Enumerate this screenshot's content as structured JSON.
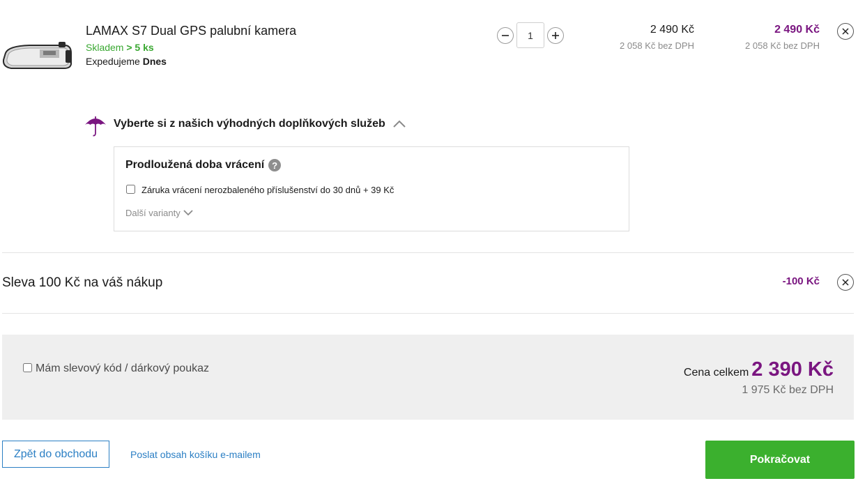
{
  "product": {
    "name": "LAMAX S7 Dual GPS palubní kamera",
    "stock_prefix": "Skladem",
    "stock_value": "> 5 ks",
    "shipping_prefix": "Expedujeme",
    "shipping_value": "Dnes",
    "quantity": "1",
    "unit_price": "2 490 Kč",
    "unit_price_novat": "2 058 Kč bez DPH",
    "total_price": "2 490 Kč",
    "total_price_novat": "2 058 Kč bez DPH"
  },
  "services": {
    "toggle_label": "Vyberte si z našich výhodných doplňkových služeb",
    "box_title": "Prodloužená doba vrácení",
    "help_symbol": "?",
    "warranty_option": "Záruka vrácení nerozbaleného příslušenství do 30 dnů + 39 Kč",
    "more_variants": "Další varianty"
  },
  "discount": {
    "label": "Sleva 100 Kč na váš nákup",
    "value": "-100 Kč"
  },
  "summary": {
    "coupon_label": "Mám slevový kód / dárkový poukaz",
    "total_label": "Cena celkem",
    "total_value": "2 390 Kč",
    "total_novat": "1 975 Kč bez DPH"
  },
  "footer": {
    "back_label": "Zpět do obchodu",
    "email_link": "Poslat obsah košíku e-mailem",
    "continue_label": "Pokračovat"
  },
  "colors": {
    "accent_purple": "#7a1680",
    "stock_green": "#3aa832",
    "continue_green": "#3bb02e",
    "link_blue": "#2b7fc4"
  },
  "icons": {
    "product_image": "dashcam-mirror-image",
    "minus": "minus-icon",
    "plus": "plus-icon",
    "remove": "close-icon",
    "services": "umbrella-icon",
    "toggle": "chevron-up-icon",
    "more": "chevron-down-icon",
    "help": "help-icon"
  }
}
